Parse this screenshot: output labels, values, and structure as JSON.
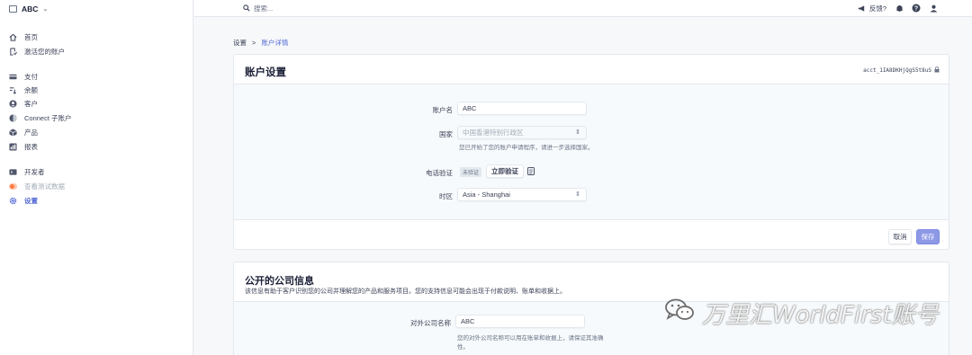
{
  "sidebar": {
    "account_name": "ABC",
    "nav_top": [
      {
        "label": "首页",
        "icon": "home-icon"
      },
      {
        "label": "激活您的账户",
        "icon": "activate-icon"
      }
    ],
    "nav_main": [
      {
        "label": "支付",
        "icon": "payments-icon"
      },
      {
        "label": "余额",
        "icon": "balance-icon"
      },
      {
        "label": "客户",
        "icon": "customers-icon"
      },
      {
        "label": "Connect 子账户",
        "icon": "connect-icon"
      },
      {
        "label": "产品",
        "icon": "products-icon"
      },
      {
        "label": "报表",
        "icon": "reports-icon"
      }
    ],
    "nav_bottom": [
      {
        "label": "开发者",
        "icon": "developers-icon"
      },
      {
        "label": "查看测试数据",
        "icon": "test-data-toggle"
      },
      {
        "label": "设置",
        "icon": "gear-icon"
      }
    ]
  },
  "topbar": {
    "search_placeholder": "搜索...",
    "feedback_label": "反馈?"
  },
  "breadcrumb": {
    "parent": "设置",
    "separator": ">",
    "current": "账户详情"
  },
  "account_settings": {
    "title": "账户设置",
    "account_id": "acct_1IA8DKHjQgS5t8uS",
    "name_label": "账户名",
    "name_value": "ABC",
    "country_label": "国家",
    "country_value": "中国香港特别行政区",
    "country_help": "您已开始了您的账户申请程序，请进一步选择国家。",
    "phone_label": "电话验证",
    "phone_status": "未验证",
    "verify_button": "立即验证",
    "timezone_label": "时区",
    "timezone_value": "Asia - Shanghai",
    "cancel_button": "取消",
    "save_button": "保存"
  },
  "public_info": {
    "title": "公开的公司信息",
    "description": "该信息有助于客户识别您的公司并理解您的产品和服务项目。您的支持信息可能会出现于付款说明、账单和收据上。",
    "company_name_label": "对外公司名称",
    "company_name_value": "ABC",
    "company_name_help_1": "您的对外公司名称可以用在账单和收据上，请保证其准确",
    "company_name_help_2": "性。"
  },
  "watermark": {
    "text": "万里汇WorldFirst账号"
  },
  "colors": {
    "accent": "#5469d4",
    "save_button": "#8d98e6",
    "test_toggle": "#ff7a45"
  }
}
